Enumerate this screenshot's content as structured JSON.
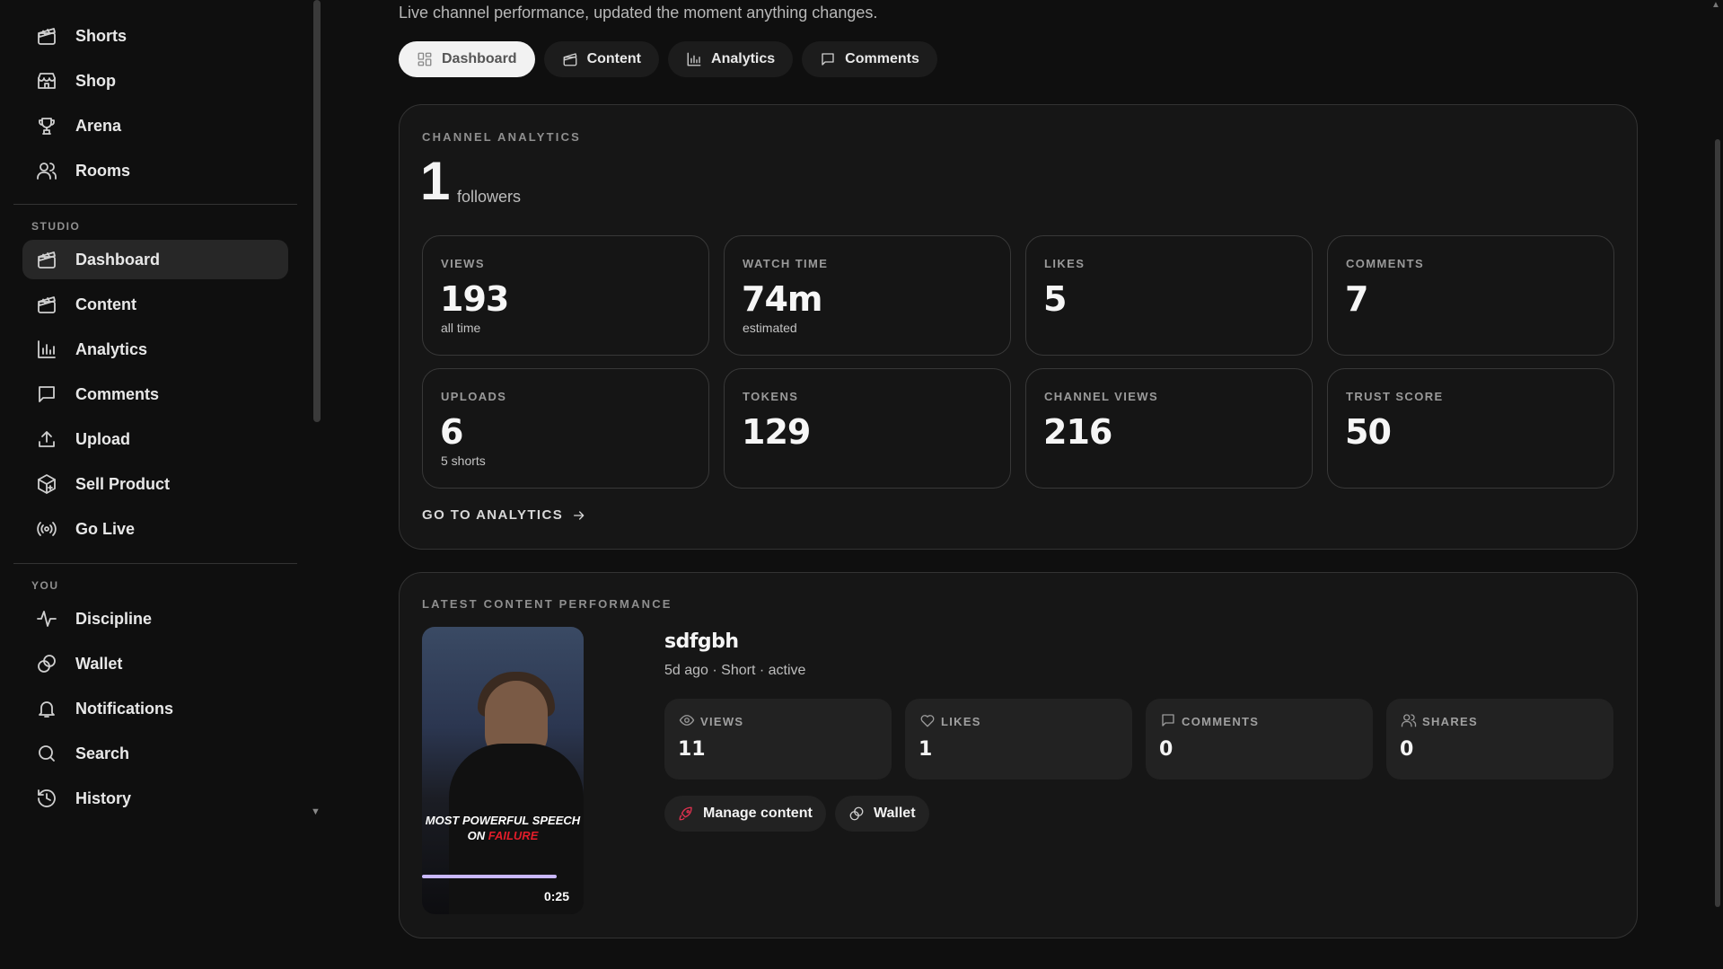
{
  "sidebar": {
    "top_items": [
      {
        "label": "Shorts",
        "icon": "shorts-icon"
      },
      {
        "label": "Shop",
        "icon": "shop-icon"
      },
      {
        "label": "Arena",
        "icon": "trophy-icon"
      },
      {
        "label": "Rooms",
        "icon": "users-icon"
      }
    ],
    "studio_label": "STUDIO",
    "studio_items": [
      {
        "label": "Dashboard",
        "icon": "clapper-icon",
        "active": true
      },
      {
        "label": "Content",
        "icon": "clapper-icon"
      },
      {
        "label": "Analytics",
        "icon": "bar-chart-icon"
      },
      {
        "label": "Comments",
        "icon": "comment-icon"
      },
      {
        "label": "Upload",
        "icon": "upload-icon"
      },
      {
        "label": "Sell Product",
        "icon": "package-icon"
      },
      {
        "label": "Go Live",
        "icon": "broadcast-icon"
      }
    ],
    "you_label": "YOU",
    "you_items": [
      {
        "label": "Discipline",
        "icon": "activity-icon"
      },
      {
        "label": "Wallet",
        "icon": "coins-icon"
      },
      {
        "label": "Notifications",
        "icon": "bell-icon"
      },
      {
        "label": "Search",
        "icon": "search-icon"
      },
      {
        "label": "History",
        "icon": "history-icon"
      }
    ]
  },
  "header": {
    "subtitle": "Live channel performance, updated the moment anything changes."
  },
  "tabs": [
    {
      "label": "Dashboard",
      "icon": "grid-icon",
      "active": true
    },
    {
      "label": "Content",
      "icon": "clapper-icon"
    },
    {
      "label": "Analytics",
      "icon": "bar-chart-icon"
    },
    {
      "label": "Comments",
      "icon": "comment-icon"
    }
  ],
  "channel_analytics": {
    "title": "CHANNEL ANALYTICS",
    "followers_count": "1",
    "followers_label": "followers",
    "stats": [
      {
        "label": "VIEWS",
        "value": "193",
        "sub": "all time"
      },
      {
        "label": "WATCH TIME",
        "value": "74m",
        "sub": "estimated"
      },
      {
        "label": "LIKES",
        "value": "5",
        "sub": ""
      },
      {
        "label": "COMMENTS",
        "value": "7",
        "sub": ""
      },
      {
        "label": "UPLOADS",
        "value": "6",
        "sub": "5 shorts"
      },
      {
        "label": "TOKENS",
        "value": "129",
        "sub": ""
      },
      {
        "label": "CHANNEL VIEWS",
        "value": "216",
        "sub": ""
      },
      {
        "label": "TRUST SCORE",
        "value": "50",
        "sub": ""
      }
    ],
    "goto_label": "GO TO ANALYTICS"
  },
  "latest_content": {
    "title": "LATEST CONTENT PERFORMANCE",
    "video_title": "sdfgbh",
    "meta": "5d ago · Short · active",
    "thumbnail_caption_line1": "MOST POWERFUL SPEECH",
    "thumbnail_caption_line2_a": "ON ",
    "thumbnail_caption_line2_b": "FAILURE",
    "duration": "0:25",
    "metrics": [
      {
        "label": "VIEWS",
        "value": "11",
        "icon": "eye-icon"
      },
      {
        "label": "LIKES",
        "value": "1",
        "icon": "heart-icon"
      },
      {
        "label": "COMMENTS",
        "value": "0",
        "icon": "comment-icon"
      },
      {
        "label": "SHARES",
        "value": "0",
        "icon": "users-icon"
      }
    ],
    "actions": [
      {
        "label": "Manage content",
        "icon": "rocket-icon",
        "color": "#e0314f"
      },
      {
        "label": "Wallet",
        "icon": "coins-icon",
        "color": "#cfcfcf"
      }
    ]
  }
}
